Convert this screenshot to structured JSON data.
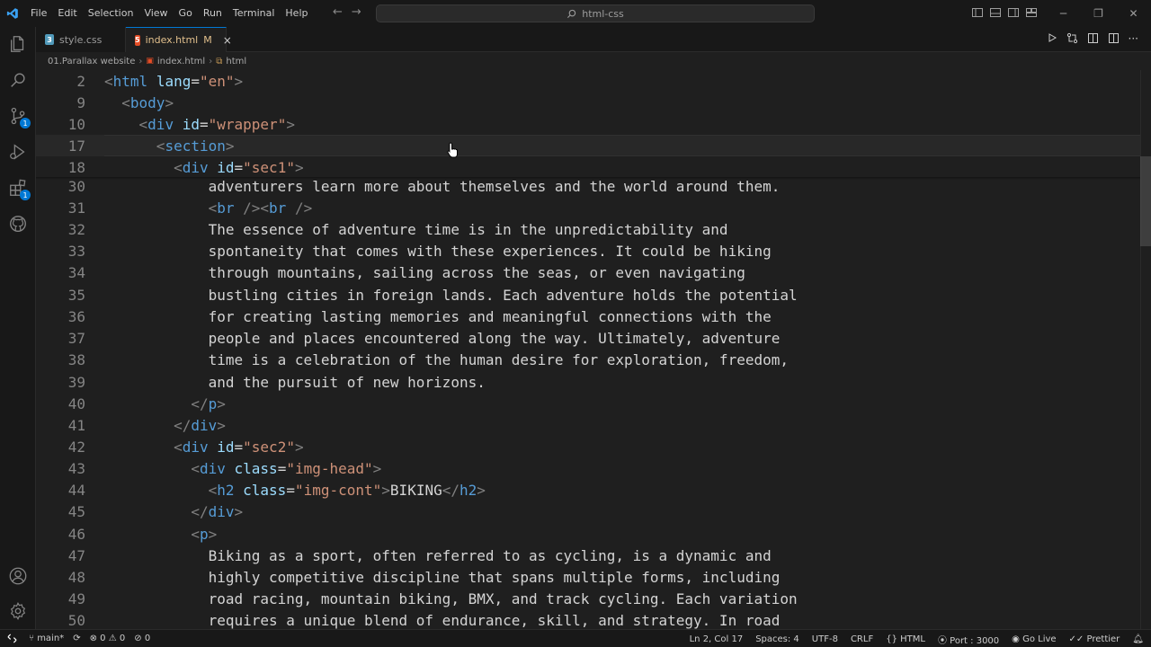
{
  "menu": [
    "File",
    "Edit",
    "Selection",
    "View",
    "Go",
    "Run",
    "Terminal",
    "Help"
  ],
  "search": {
    "text": "html-css"
  },
  "tabs": [
    {
      "label": "style.css",
      "type": "css"
    },
    {
      "label": "index.html",
      "type": "html",
      "modified": "M",
      "close": "×"
    }
  ],
  "breadcrumb": {
    "folder": "01.Parallax website",
    "file": "index.html",
    "symbol": "html"
  },
  "editor": {
    "lines": [
      {
        "n": "2",
        "html": "<span class='tg'>&lt;</span><span class='tn'>html</span> <span class='at'>lang</span><span class='tx'>=</span><span class='st'>\"en\"</span><span class='tg'>&gt;</span>"
      },
      {
        "n": "9",
        "html": "  <span class='tg'>&lt;</span><span class='tn'>body</span><span class='tg'>&gt;</span>"
      },
      {
        "n": "10",
        "html": "    <span class='tg'>&lt;</span><span class='tn'>div</span> <span class='at'>id</span><span class='tx'>=</span><span class='st'>\"wrapper\"</span><span class='tg'>&gt;</span>"
      },
      {
        "n": "17",
        "html": "      <span class='tg'>&lt;</span><span class='tn'>section</span><span class='tg'>&gt;</span>"
      },
      {
        "n": "18",
        "html": "        <span class='tg'>&lt;</span><span class='tn'>div</span> <span class='at'>id</span><span class='tx'>=</span><span class='st'>\"sec1\"</span><span class='tg'>&gt;</span>"
      },
      {
        "n": "30",
        "html": "            <span class='tx'>adventurers learn more about themselves and the world around them.</span>"
      },
      {
        "n": "31",
        "html": "            <span class='tg'>&lt;</span><span class='tn'>br</span> <span class='tg'>/&gt;&lt;</span><span class='tn'>br</span> <span class='tg'>/&gt;</span>"
      },
      {
        "n": "32",
        "html": "            <span class='tx'>The essence of adventure time is in the unpredictability and</span>"
      },
      {
        "n": "33",
        "html": "            <span class='tx'>spontaneity that comes with these experiences. It could be hiking</span>"
      },
      {
        "n": "34",
        "html": "            <span class='tx'>through mountains, sailing across the seas, or even navigating</span>"
      },
      {
        "n": "35",
        "html": "            <span class='tx'>bustling cities in foreign lands. Each adventure holds the potential</span>"
      },
      {
        "n": "36",
        "html": "            <span class='tx'>for creating lasting memories and meaningful connections with the</span>"
      },
      {
        "n": "37",
        "html": "            <span class='tx'>people and places encountered along the way. Ultimately, adventure</span>"
      },
      {
        "n": "38",
        "html": "            <span class='tx'>time is a celebration of the human desire for exploration, freedom,</span>"
      },
      {
        "n": "39",
        "html": "            <span class='tx'>and the pursuit of new horizons.</span>"
      },
      {
        "n": "40",
        "html": "          <span class='tg'>&lt;/</span><span class='tn'>p</span><span class='tg'>&gt;</span>"
      },
      {
        "n": "41",
        "html": "        <span class='tg'>&lt;/</span><span class='tn'>div</span><span class='tg'>&gt;</span>"
      },
      {
        "n": "42",
        "html": "        <span class='tg'>&lt;</span><span class='tn'>div</span> <span class='at'>id</span><span class='tx'>=</span><span class='st'>\"sec2\"</span><span class='tg'>&gt;</span>"
      },
      {
        "n": "43",
        "html": "          <span class='tg'>&lt;</span><span class='tn'>div</span> <span class='at'>class</span><span class='tx'>=</span><span class='st'>\"img-head\"</span><span class='tg'>&gt;</span>"
      },
      {
        "n": "44",
        "html": "            <span class='tg'>&lt;</span><span class='tn'>h2</span> <span class='at'>class</span><span class='tx'>=</span><span class='st'>\"img-cont\"</span><span class='tg'>&gt;</span><span class='tx'>BIKING</span><span class='tg'>&lt;/</span><span class='tn'>h2</span><span class='tg'>&gt;</span>"
      },
      {
        "n": "45",
        "html": "          <span class='tg'>&lt;/</span><span class='tn'>div</span><span class='tg'>&gt;</span>"
      },
      {
        "n": "46",
        "html": "          <span class='tg'>&lt;</span><span class='tn'>p</span><span class='tg'>&gt;</span>"
      },
      {
        "n": "47",
        "html": "            <span class='tx'>Biking as a sport, often referred to as cycling, is a dynamic and</span>"
      },
      {
        "n": "48",
        "html": "            <span class='tx'>highly competitive discipline that spans multiple forms, including</span>"
      },
      {
        "n": "49",
        "html": "            <span class='tx'>road racing, mountain biking, BMX, and track cycling. Each variation</span>"
      },
      {
        "n": "50",
        "html": "            <span class='tx'>requires a unique blend of endurance, skill, and strategy. In road</span>"
      }
    ]
  },
  "status": {
    "branch": "main*",
    "errors": "0",
    "warnings": "0",
    "ports": "0",
    "position": "Ln 2, Col 17",
    "spaces": "Spaces: 4",
    "encoding": "UTF-8",
    "eol": "CRLF",
    "language": "HTML",
    "port": "Port : 3000",
    "golive": "Go Live",
    "prettier": "Prettier"
  },
  "colors": {
    "accent": "#0078d4",
    "modified": "#e2c08d"
  }
}
